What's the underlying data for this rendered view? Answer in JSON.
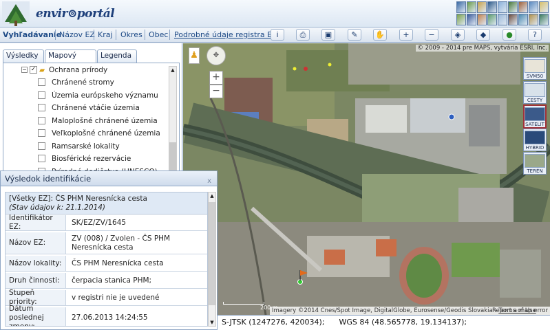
{
  "header": {
    "logo_text": "envir⊚portál"
  },
  "nav": {
    "items": [
      "Vyhľadávanie",
      "Názov EZ",
      "Kraj",
      "Okres",
      "Obec",
      "Podrobné údaje registra EZ"
    ],
    "tools": [
      "info-icon",
      "print-icon",
      "screen-icon",
      "erase-icon",
      "pan-icon",
      "zoom-in-icon",
      "zoom-out-icon",
      "zoom-extent-icon",
      "zoom-select-icon",
      "globe-icon",
      "help-icon"
    ]
  },
  "left": {
    "tabs": [
      "Výsledky",
      "Mapový obsah",
      "Legenda"
    ],
    "tree": {
      "group": "Ochrana prírody",
      "items": [
        "Chránené stromy",
        "Územia európskeho významu",
        "Chránené vtáčie územia",
        "Maloplošné chránené územia",
        "Veľkoplošné chránené územia",
        "Ramsarské lokality",
        "Biosférické rezervácie",
        "Prírodné dedičstvo (UNESCO)"
      ]
    }
  },
  "panel": {
    "title": "Výsledok identifikácie",
    "close": "x",
    "header_line1": "[Všetky EZ]: ČS PHM Neresnícka cesta",
    "header_line2": "(Stav údajov k: 21.1.2014)",
    "rows": [
      {
        "key": "Identifikátor EZ:",
        "value": "SK/EZ/ZV/1645"
      },
      {
        "key": "Názov EZ:",
        "value": "ZV (008) / Zvolen - ČS PHM Neresnícka cesta"
      },
      {
        "key": "Názov lokality:",
        "value": "ČS PHM Neresnícka cesta"
      },
      {
        "key": "Druh činnosti:",
        "value": "čerpacia stanica PHM;"
      },
      {
        "key": "Stupeň priority:",
        "value": "v registri nie je uvedené"
      },
      {
        "key": "Dátum poslednej zmeny:",
        "value": "27.06.2013 14:24:55"
      }
    ]
  },
  "map": {
    "copyright": "© 2009 - 2014 pre MAPS, vytvária ESRI, Inc.",
    "attribution": "Imagery ©2014 Cnes/Spot Image, DigitalGlobe, Eurosense/Geodis Slovakia",
    "terms": "Terms of Use",
    "report": "Report a map error",
    "scale": "200 m",
    "layers": [
      "SVM50",
      "CESTY",
      "SATELIT",
      "HYBRID",
      "TERÉN"
    ],
    "zoom_in": "+",
    "zoom_out": "−"
  },
  "status": {
    "sjtsk": "S-JTSK (1247276, 420034);",
    "wgs": "WGS 84 (48.565778, 19.134137);"
  },
  "colors": {
    "accent": "#1d4a86",
    "border": "#8ea6c5"
  }
}
